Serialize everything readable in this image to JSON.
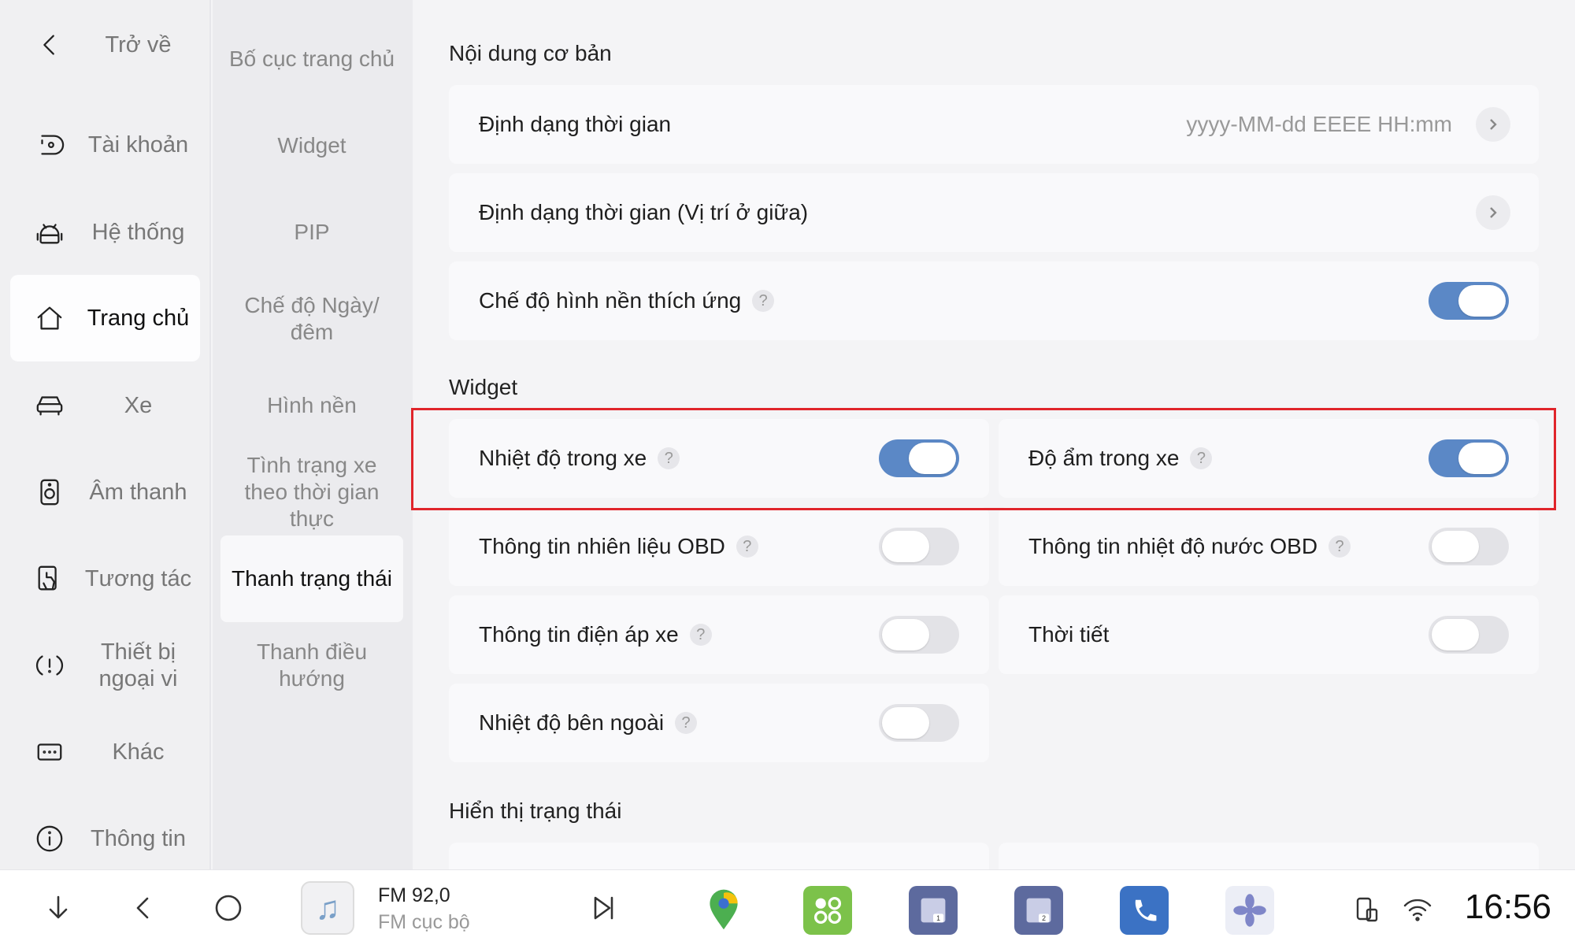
{
  "nav_primary": [
    {
      "label": "Trở về",
      "icon": "back-chevron-icon"
    },
    {
      "label": "Tài khoản",
      "icon": "account-icon"
    },
    {
      "label": "Hệ thống",
      "icon": "android-icon"
    },
    {
      "label": "Trang chủ",
      "icon": "home-icon",
      "active": true
    },
    {
      "label": "Xe",
      "icon": "car-icon"
    },
    {
      "label": "Âm thanh",
      "icon": "speaker-icon"
    },
    {
      "label": "Tương tác",
      "icon": "touch-icon"
    },
    {
      "label": "Thiết bị ngoại vi",
      "icon": "peripheral-icon"
    },
    {
      "label": "Khác",
      "icon": "more-icon"
    },
    {
      "label": "Thông tin",
      "icon": "info-icon"
    }
  ],
  "nav_secondary": [
    {
      "label": "Bố cục trang chủ"
    },
    {
      "label": "Widget"
    },
    {
      "label": "PIP"
    },
    {
      "label": "Chế độ Ngày/ đêm"
    },
    {
      "label": "Hình nền"
    },
    {
      "label": "Tình trạng xe theo thời gian thực"
    },
    {
      "label": "Thanh trạng thái",
      "active": true
    },
    {
      "label": "Thanh điều hướng"
    }
  ],
  "sections": {
    "basic": {
      "title": "Nội dung cơ bản",
      "time_format": {
        "label": "Định dạng thời gian",
        "value": "yyyy-MM-dd EEEE HH:mm"
      },
      "time_format_center": {
        "label": "Định dạng thời gian (Vị trí ở giữa)"
      },
      "adaptive_wallpaper": {
        "label": "Chế độ hình nền thích ứng",
        "on": true
      }
    },
    "widget": {
      "title": "Widget",
      "items": [
        {
          "label": "Nhiệt độ trong xe",
          "on": true
        },
        {
          "label": "Độ ẩm trong xe",
          "on": true
        },
        {
          "label": "Thông tin nhiên liệu OBD",
          "on": false
        },
        {
          "label": "Thông tin nhiệt độ nước OBD",
          "on": false
        },
        {
          "label": "Thông tin điện áp xe",
          "on": false
        },
        {
          "label": "Thời tiết",
          "on": false
        },
        {
          "label": "Nhiệt độ bên ngoài",
          "on": false
        }
      ]
    },
    "status": {
      "title": "Hiển thị trạng thái"
    }
  },
  "help_glyph": "?",
  "bottom_bar": {
    "media_title": "FM 92,0",
    "media_subtitle": "FM cục bộ",
    "music_glyph": "♫",
    "clock": "16:56",
    "colors": {
      "maps": "#4caf50",
      "apps": "#7cc24a",
      "split": "#5d6a9e",
      "phone": "#3b72c4",
      "fan": "#7f86c8"
    }
  },
  "colors": {
    "toggle_on": "#5b88c6",
    "highlight": "#e0252b"
  }
}
